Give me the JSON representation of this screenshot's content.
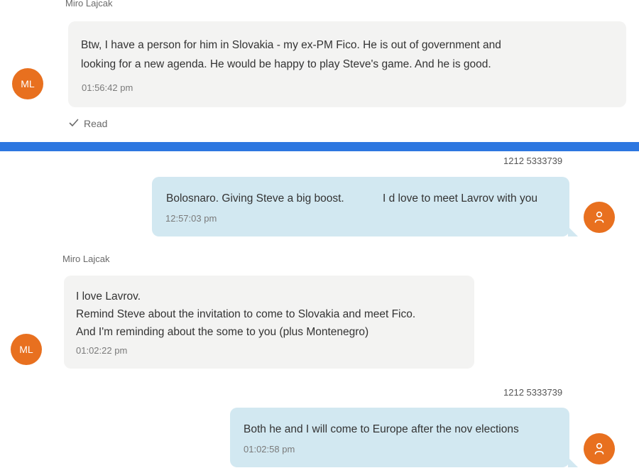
{
  "conversation_top": {
    "sender_name": "Miro Lajcak",
    "avatar_initials": "ML",
    "message": {
      "lines": [
        "Btw, I have a person for him in Slovakia - my ex-PM Fico. He is out of government and",
        "looking for a new agenda. He would be happy to play Steve's game. And he is good."
      ],
      "time": "01:56:42 pm"
    },
    "read_status": "Read",
    "read_icon": "checkmark-icon"
  },
  "divider_color": "#2d77e0",
  "conversation_bottom": {
    "messages": [
      {
        "direction": "outgoing",
        "phone": "1212 5333739",
        "text_part1": "Bolosnaro. Giving Steve a big boost.",
        "text_part2": "I d love to meet Lavrov with you",
        "time": "12:57:03 pm",
        "avatar_icon": "user-icon"
      },
      {
        "direction": "incoming",
        "sender_name": "Miro Lajcak",
        "avatar_initials": "ML",
        "lines": [
          "I love Lavrov.",
          "Remind Steve about the invitation to come to Slovakia and meet Fico.",
          "And I'm reminding about the some to you (plus Montenegro)"
        ],
        "time": "01:02:22 pm"
      },
      {
        "direction": "outgoing",
        "phone": "1212 5333739",
        "text": "Both he and I will come to Europe after the nov elections",
        "time": "01:02:58 pm",
        "avatar_icon": "user-icon"
      }
    ]
  },
  "colors": {
    "avatar_orange": "#e8701f",
    "incoming_bubble": "#f3f3f2",
    "outgoing_bubble": "#d2e8f1"
  }
}
